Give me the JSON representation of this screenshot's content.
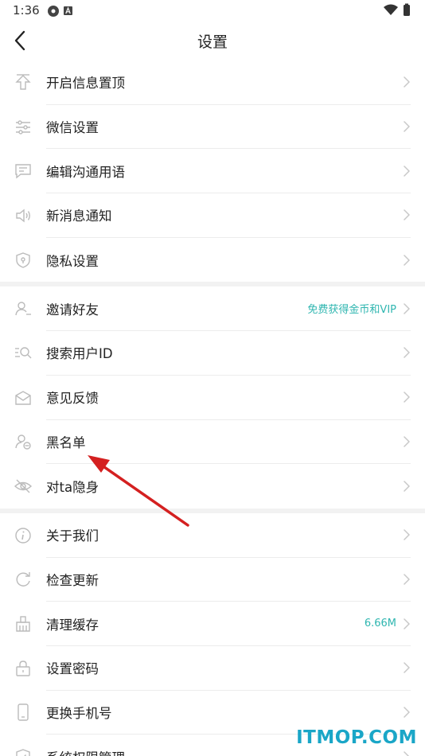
{
  "status_bar": {
    "time": "1:36"
  },
  "nav": {
    "title": "设置"
  },
  "groups": [
    [
      {
        "icon": "pin-top-icon",
        "label": "开启信息置顶"
      },
      {
        "icon": "sliders-icon",
        "label": "微信设置"
      },
      {
        "icon": "message-edit-icon",
        "label": "编辑沟通用语"
      },
      {
        "icon": "speaker-icon",
        "label": "新消息通知"
      },
      {
        "icon": "shield-icon",
        "label": "隐私设置"
      }
    ],
    [
      {
        "icon": "add-friend-icon",
        "label": "邀请好友",
        "hint": "免费获得金币和VIP"
      },
      {
        "icon": "search-user-icon",
        "label": "搜索用户ID"
      },
      {
        "icon": "feedback-icon",
        "label": "意见反馈"
      },
      {
        "icon": "blocked-user-icon",
        "label": "黑名单"
      },
      {
        "icon": "eye-hidden-icon",
        "label": "对ta隐身"
      }
    ],
    [
      {
        "icon": "info-icon",
        "label": "关于我们"
      },
      {
        "icon": "refresh-icon",
        "label": "检查更新"
      },
      {
        "icon": "broom-icon",
        "label": "清理缓存",
        "hint": "6.66M"
      },
      {
        "icon": "lock-icon",
        "label": "设置密码"
      },
      {
        "icon": "phone-icon",
        "label": "更换手机号"
      },
      {
        "icon": "permission-icon",
        "label": "系统权限管理"
      }
    ]
  ],
  "watermark": "ITMOP.COM",
  "colors": {
    "accent": "#2fb6b0",
    "arrow": "#d42020",
    "watermark": "#1aa6c7"
  }
}
